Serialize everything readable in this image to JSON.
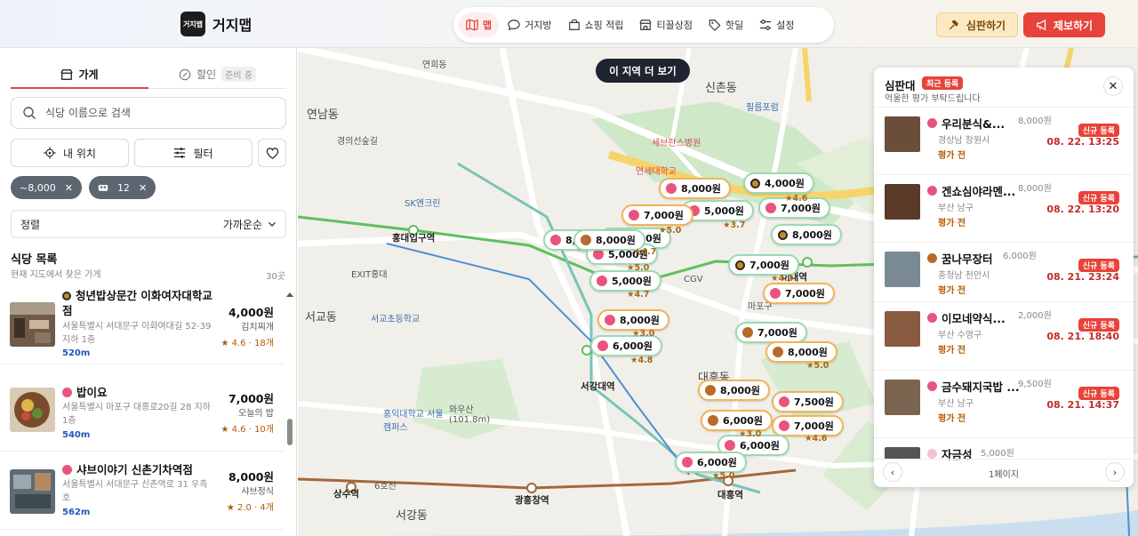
{
  "app": {
    "logo_text": "거지맵",
    "title": "거지맵"
  },
  "nav": [
    {
      "label": "맵",
      "icon": "map-icon",
      "active": true
    },
    {
      "label": "거지방",
      "icon": "chat-icon"
    },
    {
      "label": "쇼핑 적립",
      "icon": "shopping-bag-icon"
    },
    {
      "label": "티끌상점",
      "icon": "store-icon"
    },
    {
      "label": "핫딜",
      "icon": "tag-icon"
    },
    {
      "label": "설정",
      "icon": "settings-sliders-icon"
    }
  ],
  "header_buttons": {
    "judge": "심판하기",
    "report": "제보하기"
  },
  "sidebar": {
    "tabs": {
      "store": "가게",
      "sale": "할인",
      "sale_badge": "준비 중"
    },
    "search_placeholder": "식당 이름으로 검색",
    "my_location": "내 위치",
    "filter": "필터",
    "chips": {
      "price": "~8,000",
      "count": "12"
    },
    "sort_label": "정렬",
    "sort_value": "가까운순",
    "list_title": "식당 목록",
    "list_subtitle": "현재 지도에서 찾은 가게",
    "list_count": "30곳",
    "items": [
      {
        "name": "청년밥상문간 이화여자대학교점",
        "addr": "서울특별시 서대문구 이화여대길 52-39 지하 1층",
        "dist": "520m",
        "price": "4,000원",
        "menu": "김치찌개",
        "rating": "★ 4.6 · 18개"
      },
      {
        "name": "밥이요",
        "addr": "서울특별시 마포구 대흥로20길 28 지하1층",
        "dist": "540m",
        "price": "7,000원",
        "menu": "오늘의 밥",
        "rating": "★ 4.6 · 10개"
      },
      {
        "name": "샤브이야기 신촌기차역점",
        "addr": "서울특별시 서대문구 신촌역로 31 우측호",
        "dist": "562m",
        "price": "8,000원",
        "menu": "샤브정식",
        "rating": "★ 2.0 · 4개"
      }
    ]
  },
  "map": {
    "area_button": "이 지역 더 보기",
    "labels": {
      "sinchon": "신촌동",
      "yeonhui": "연희동",
      "yeonnam": "연남동",
      "daeheung": "대흥동",
      "seogyo": "서교동",
      "seogang": "서강동",
      "hongdae": "홍대입구역",
      "exit": "EXIT홍대",
      "seogangdae": "서강대역",
      "sangsu": "상수역",
      "gwangheung": "광흥창역",
      "ewha": "이대역",
      "daeheung_st": "대흥역",
      "hongik": "홍익대학교 서울캠퍼스",
      "wausan": "와우산 (101.8m)",
      "severance": "세브란스병원",
      "yonsei": "연세대학교",
      "gyeongui": "경의선숲길",
      "sk": "SK엔크린",
      "cgv": "CGV",
      "mapo": "마포구",
      "line6": "6호선",
      "philum": "필름포럼",
      "seoul_sch": "서교초등학교"
    },
    "pins": [
      {
        "price": "8,000원",
        "color": "orange",
        "dot": "r"
      },
      {
        "price": "4,000원",
        "color": "green",
        "dot": "c"
      },
      {
        "price": "7,000원",
        "color": "green",
        "dot": "r"
      },
      {
        "price": "5,000원",
        "color": "green",
        "dot": "r"
      },
      {
        "price": "7,000원",
        "color": "orange",
        "dot": "r"
      },
      {
        "price": "8,000원",
        "color": "green",
        "dot": "r"
      },
      {
        "price": "4,000원",
        "color": "green",
        "dot": "b"
      },
      {
        "price": "8,000원",
        "color": "green",
        "dot": "c"
      },
      {
        "price": "5,000원",
        "color": "green",
        "dot": "r"
      },
      {
        "price": "7,000원",
        "color": "green",
        "dot": "c"
      },
      {
        "price": "5,000원",
        "color": "green",
        "dot": "r"
      },
      {
        "price": "7,000원",
        "color": "orange",
        "dot": "r"
      },
      {
        "price": "8,000원",
        "color": "orange",
        "dot": "r"
      },
      {
        "price": "7,000원",
        "color": "green",
        "dot": "b"
      },
      {
        "price": "6,000원",
        "color": "green",
        "dot": "r"
      },
      {
        "price": "8,000원",
        "color": "orange",
        "dot": "b"
      },
      {
        "price": "8,000원",
        "color": "orange",
        "dot": "b"
      },
      {
        "price": "7,500원",
        "color": "orange",
        "dot": "r"
      },
      {
        "price": "6,000원",
        "color": "orange",
        "dot": "b"
      },
      {
        "price": "7,000원",
        "color": "orange",
        "dot": "r"
      },
      {
        "price": "6,000원",
        "color": "green",
        "dot": "r"
      },
      {
        "price": "6,000원",
        "color": "green",
        "dot": "r"
      },
      {
        "price": "8,000원",
        "color": "green",
        "dot": "b"
      }
    ],
    "ratings": [
      "★4.6",
      "★3.7",
      "★5.0",
      "★4.7",
      "★5.0",
      "★4.7",
      "★3.0",
      "★4.8",
      "★4.0",
      "★5.0",
      "★3.0",
      "★4.6",
      "★5.0"
    ]
  },
  "panel": {
    "title": "심판대",
    "badge": "최근 등록",
    "subtitle": "억울한 평가 부탁드립니다",
    "close": "✕",
    "page": "1페이지",
    "reviews": [
      {
        "name": "우리분식&...",
        "price": "8,000원",
        "loc": "경상남 창원시",
        "state": "평가 전",
        "new": "신규 등록",
        "date": "08. 22. 13:25",
        "color": "#6b4e3a"
      },
      {
        "name": "겐쇼심야라멘...",
        "price": "8,000원",
        "loc": "부산 남구",
        "state": "평가 전",
        "new": "신규 등록",
        "date": "08. 22. 13:20",
        "color": "#5a3b2a"
      },
      {
        "name": "꿈나무장터",
        "price": "6,000원",
        "loc": "충청남 천안시",
        "state": "평가 전",
        "new": "신규 등록",
        "date": "08. 21. 23:24",
        "color": "#7a8a94"
      },
      {
        "name": "이모네약식...",
        "price": "2,000원",
        "loc": "부산 수영구",
        "state": "평가 전",
        "new": "신규 등록",
        "date": "08. 21. 18:40",
        "color": "#8a5a40"
      },
      {
        "name": "금수돼지국밥 ...",
        "price": "9,500원",
        "loc": "부산 남구",
        "state": "평가 전",
        "new": "신규 등록",
        "date": "08. 21. 14:37",
        "color": "#7a6450"
      },
      {
        "name": "자금성",
        "price": "5,000원",
        "loc": "",
        "state": "",
        "new": "",
        "date": "",
        "color": "#555"
      }
    ]
  }
}
